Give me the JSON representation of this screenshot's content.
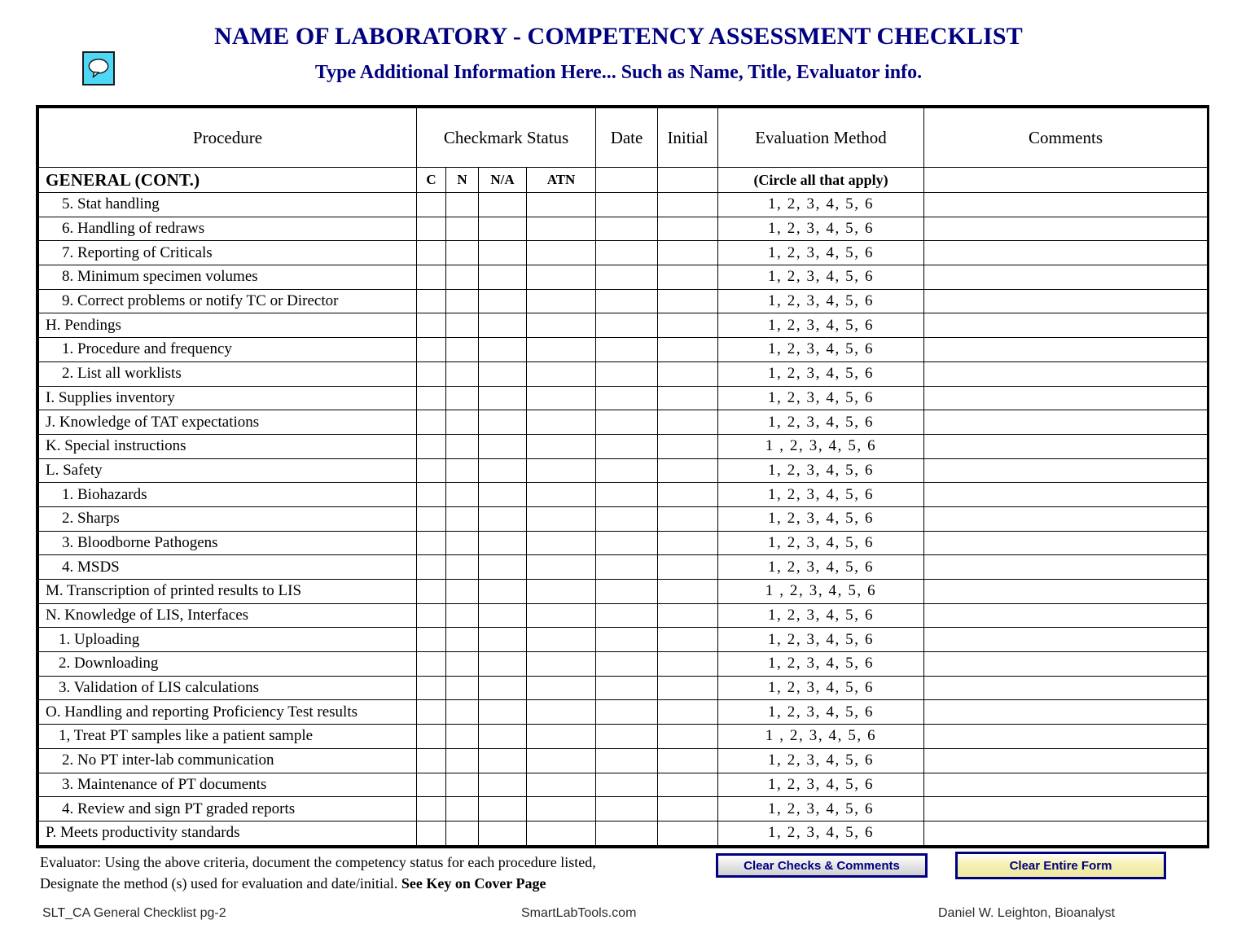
{
  "header": {
    "icon": "comment-bubble-icon",
    "title": "NAME OF LABORATORY - COMPETENCY ASSESSMENT CHECKLIST",
    "subtitle": "Type Additional Information Here... Such as Name, Title, Evaluator info.",
    "title_color": "#000080"
  },
  "table": {
    "columns": [
      {
        "label": "Procedure"
      },
      {
        "label": "Checkmark Status"
      },
      {
        "label": "Date"
      },
      {
        "label": "Initial"
      },
      {
        "label": "Evaluation Method"
      },
      {
        "label": "Comments"
      }
    ],
    "subheader": {
      "section": "GENERAL (CONT.)",
      "c": "C",
      "n": "N",
      "na": "N/A",
      "atn": "ATN",
      "date": "",
      "initial": "",
      "eval_note": "(Circle all that apply)",
      "comments": ""
    },
    "rows": [
      {
        "procedure": "5. Stat handling",
        "indent": 2,
        "eval": "1,  2,  3,  4,  5,  6",
        "date": "",
        "initial": "",
        "comments": "",
        "c": "",
        "n": "",
        "na": "",
        "atn": ""
      },
      {
        "procedure": "6. Handling of redraws",
        "indent": 2,
        "eval": "1,  2,  3,  4,  5,  6",
        "date": "",
        "initial": "",
        "comments": "",
        "c": "",
        "n": "",
        "na": "",
        "atn": ""
      },
      {
        "procedure": "7. Reporting of Criticals",
        "indent": 2,
        "eval": "1,  2,  3,  4,  5,  6",
        "date": "",
        "initial": "",
        "comments": "",
        "c": "",
        "n": "",
        "na": "",
        "atn": ""
      },
      {
        "procedure": "8. Minimum specimen volumes",
        "indent": 2,
        "eval": "1,  2,  3,  4,  5,  6",
        "date": "",
        "initial": "",
        "comments": "",
        "c": "",
        "n": "",
        "na": "",
        "atn": ""
      },
      {
        "procedure": "9. Correct problems or notify TC or Director",
        "indent": 2,
        "eval": "1,  2,  3,  4,  5,  6",
        "date": "",
        "initial": "",
        "comments": "",
        "c": "",
        "n": "",
        "na": "",
        "atn": ""
      },
      {
        "procedure": "H. Pendings",
        "indent": 1,
        "eval": "1,  2,  3,  4,  5,  6",
        "date": "",
        "initial": "",
        "comments": "",
        "c": "",
        "n": "",
        "na": "",
        "atn": ""
      },
      {
        "procedure": "1. Procedure and frequency",
        "indent": 2,
        "eval": "1,  2,  3,  4,  5,  6",
        "date": "",
        "initial": "",
        "comments": "",
        "c": "",
        "n": "",
        "na": "",
        "atn": ""
      },
      {
        "procedure": "2. List all worklists",
        "indent": 2,
        "eval": "1,  2,  3,  4,  5,  6",
        "date": "",
        "initial": "",
        "comments": "",
        "c": "",
        "n": "",
        "na": "",
        "atn": ""
      },
      {
        "procedure": "I. Supplies inventory",
        "indent": 1,
        "eval": "1,  2,  3,  4,  5,  6",
        "date": "",
        "initial": "",
        "comments": "",
        "c": "",
        "n": "",
        "na": "",
        "atn": ""
      },
      {
        "procedure": "J. Knowledge of TAT expectations",
        "indent": 1,
        "eval": "1,  2,  3,  4,  5,  6",
        "date": "",
        "initial": "",
        "comments": "",
        "c": "",
        "n": "",
        "na": "",
        "atn": ""
      },
      {
        "procedure": "K. Special instructions",
        "indent": 1,
        "eval": "1 ,  2,  3,  4,  5,  6",
        "date": "",
        "initial": "",
        "comments": "",
        "c": "",
        "n": "",
        "na": "",
        "atn": ""
      },
      {
        "procedure": "L. Safety",
        "indent": 1,
        "eval": "1,  2,  3,  4,  5,  6",
        "date": "",
        "initial": "",
        "comments": "",
        "c": "",
        "n": "",
        "na": "",
        "atn": ""
      },
      {
        "procedure": "1. Biohazards",
        "indent": 2,
        "eval": "1,  2,  3,  4,  5,  6",
        "date": "",
        "initial": "",
        "comments": "",
        "c": "",
        "n": "",
        "na": "",
        "atn": ""
      },
      {
        "procedure": "2. Sharps",
        "indent": 2,
        "eval": "1,  2,  3,  4,  5,  6",
        "date": "",
        "initial": "",
        "comments": "",
        "c": "",
        "n": "",
        "na": "",
        "atn": ""
      },
      {
        "procedure": "3. Bloodborne Pathogens",
        "indent": 2,
        "eval": "1,  2,  3,  4,  5,  6",
        "date": "",
        "initial": "",
        "comments": "",
        "c": "",
        "n": "",
        "na": "",
        "atn": ""
      },
      {
        "procedure": "4. MSDS",
        "indent": 2,
        "eval": "1,  2,  3,  4,  5,  6",
        "date": "",
        "initial": "",
        "comments": "",
        "c": "",
        "n": "",
        "na": "",
        "atn": ""
      },
      {
        "procedure": "M. Transcription of printed results to LIS",
        "indent": 1,
        "eval": "1 ,  2,  3,  4,  5,  6",
        "date": "",
        "initial": "",
        "comments": "",
        "c": "",
        "n": "",
        "na": "",
        "atn": ""
      },
      {
        "procedure": "N.  Knowledge of LIS, Interfaces",
        "indent": 1,
        "eval": "1,  2,  3,  4,  5,  6",
        "date": "",
        "initial": "",
        "comments": "",
        "c": "",
        "n": "",
        "na": "",
        "atn": ""
      },
      {
        "procedure": "1. Uploading",
        "indent": 3,
        "eval": "1,  2,  3,  4,  5,  6",
        "date": "",
        "initial": "",
        "comments": "",
        "c": "",
        "n": "",
        "na": "",
        "atn": ""
      },
      {
        "procedure": "2. Downloading",
        "indent": 3,
        "eval": "1,  2,  3,  4,  5,  6",
        "date": "",
        "initial": "",
        "comments": "",
        "c": "",
        "n": "",
        "na": "",
        "atn": ""
      },
      {
        "procedure": "3. Validation of LIS calculations",
        "indent": 3,
        "eval": "1,  2,  3,  4,  5,  6",
        "date": "",
        "initial": "",
        "comments": "",
        "c": "",
        "n": "",
        "na": "",
        "atn": ""
      },
      {
        "procedure": "O.  Handling and reporting Proficiency Test results",
        "indent": 1,
        "eval": "1,  2,  3,  4,  5,  6",
        "date": "",
        "initial": "",
        "comments": "",
        "c": "",
        "n": "",
        "na": "",
        "atn": ""
      },
      {
        "procedure": "1, Treat PT samples like a patient sample",
        "indent": 3,
        "eval": "1 ,  2,  3,  4,  5,  6",
        "date": "",
        "initial": "",
        "comments": "",
        "c": "",
        "n": "",
        "na": "",
        "atn": ""
      },
      {
        "procedure": "2. No PT inter-lab communication",
        "indent": 2,
        "eval": "1,  2,  3,  4,  5,  6",
        "date": "",
        "initial": "",
        "comments": "",
        "c": "",
        "n": "",
        "na": "",
        "atn": ""
      },
      {
        "procedure": "3. Maintenance of PT documents",
        "indent": 2,
        "eval": "1,  2,  3,  4,  5,  6",
        "date": "",
        "initial": "",
        "comments": "",
        "c": "",
        "n": "",
        "na": "",
        "atn": ""
      },
      {
        "procedure": "4. Review and sign PT graded reports",
        "indent": 2,
        "eval": "1,  2,  3,  4,  5,  6",
        "date": "",
        "initial": "",
        "comments": "",
        "c": "",
        "n": "",
        "na": "",
        "atn": ""
      },
      {
        "procedure": "P.  Meets productivity standards",
        "indent": 1,
        "eval": "1,  2,  3,  4,  5,  6",
        "date": "",
        "initial": "",
        "comments": "",
        "c": "",
        "n": "",
        "na": "",
        "atn": ""
      }
    ]
  },
  "note": {
    "line1": "Evaluator: Using the above criteria, document the competency status for each procedure listed,",
    "line2_plain": "Designate the method (s) used for evaluation and date/initial.  ",
    "line2_bold": "See Key on Cover Page"
  },
  "buttons": {
    "clear_checks": "Clear Checks & Comments",
    "clear_form": "Clear Entire Form",
    "border_color": "#000080",
    "clear_form_face": "#f7f2b8",
    "clear_checks_face": "#d4d0c8"
  },
  "footer": {
    "left": "SLT_CA General Checklist pg-2",
    "center": "SmartLabTools.com",
    "right": "Daniel W. Leighton, Bioanalyst"
  }
}
